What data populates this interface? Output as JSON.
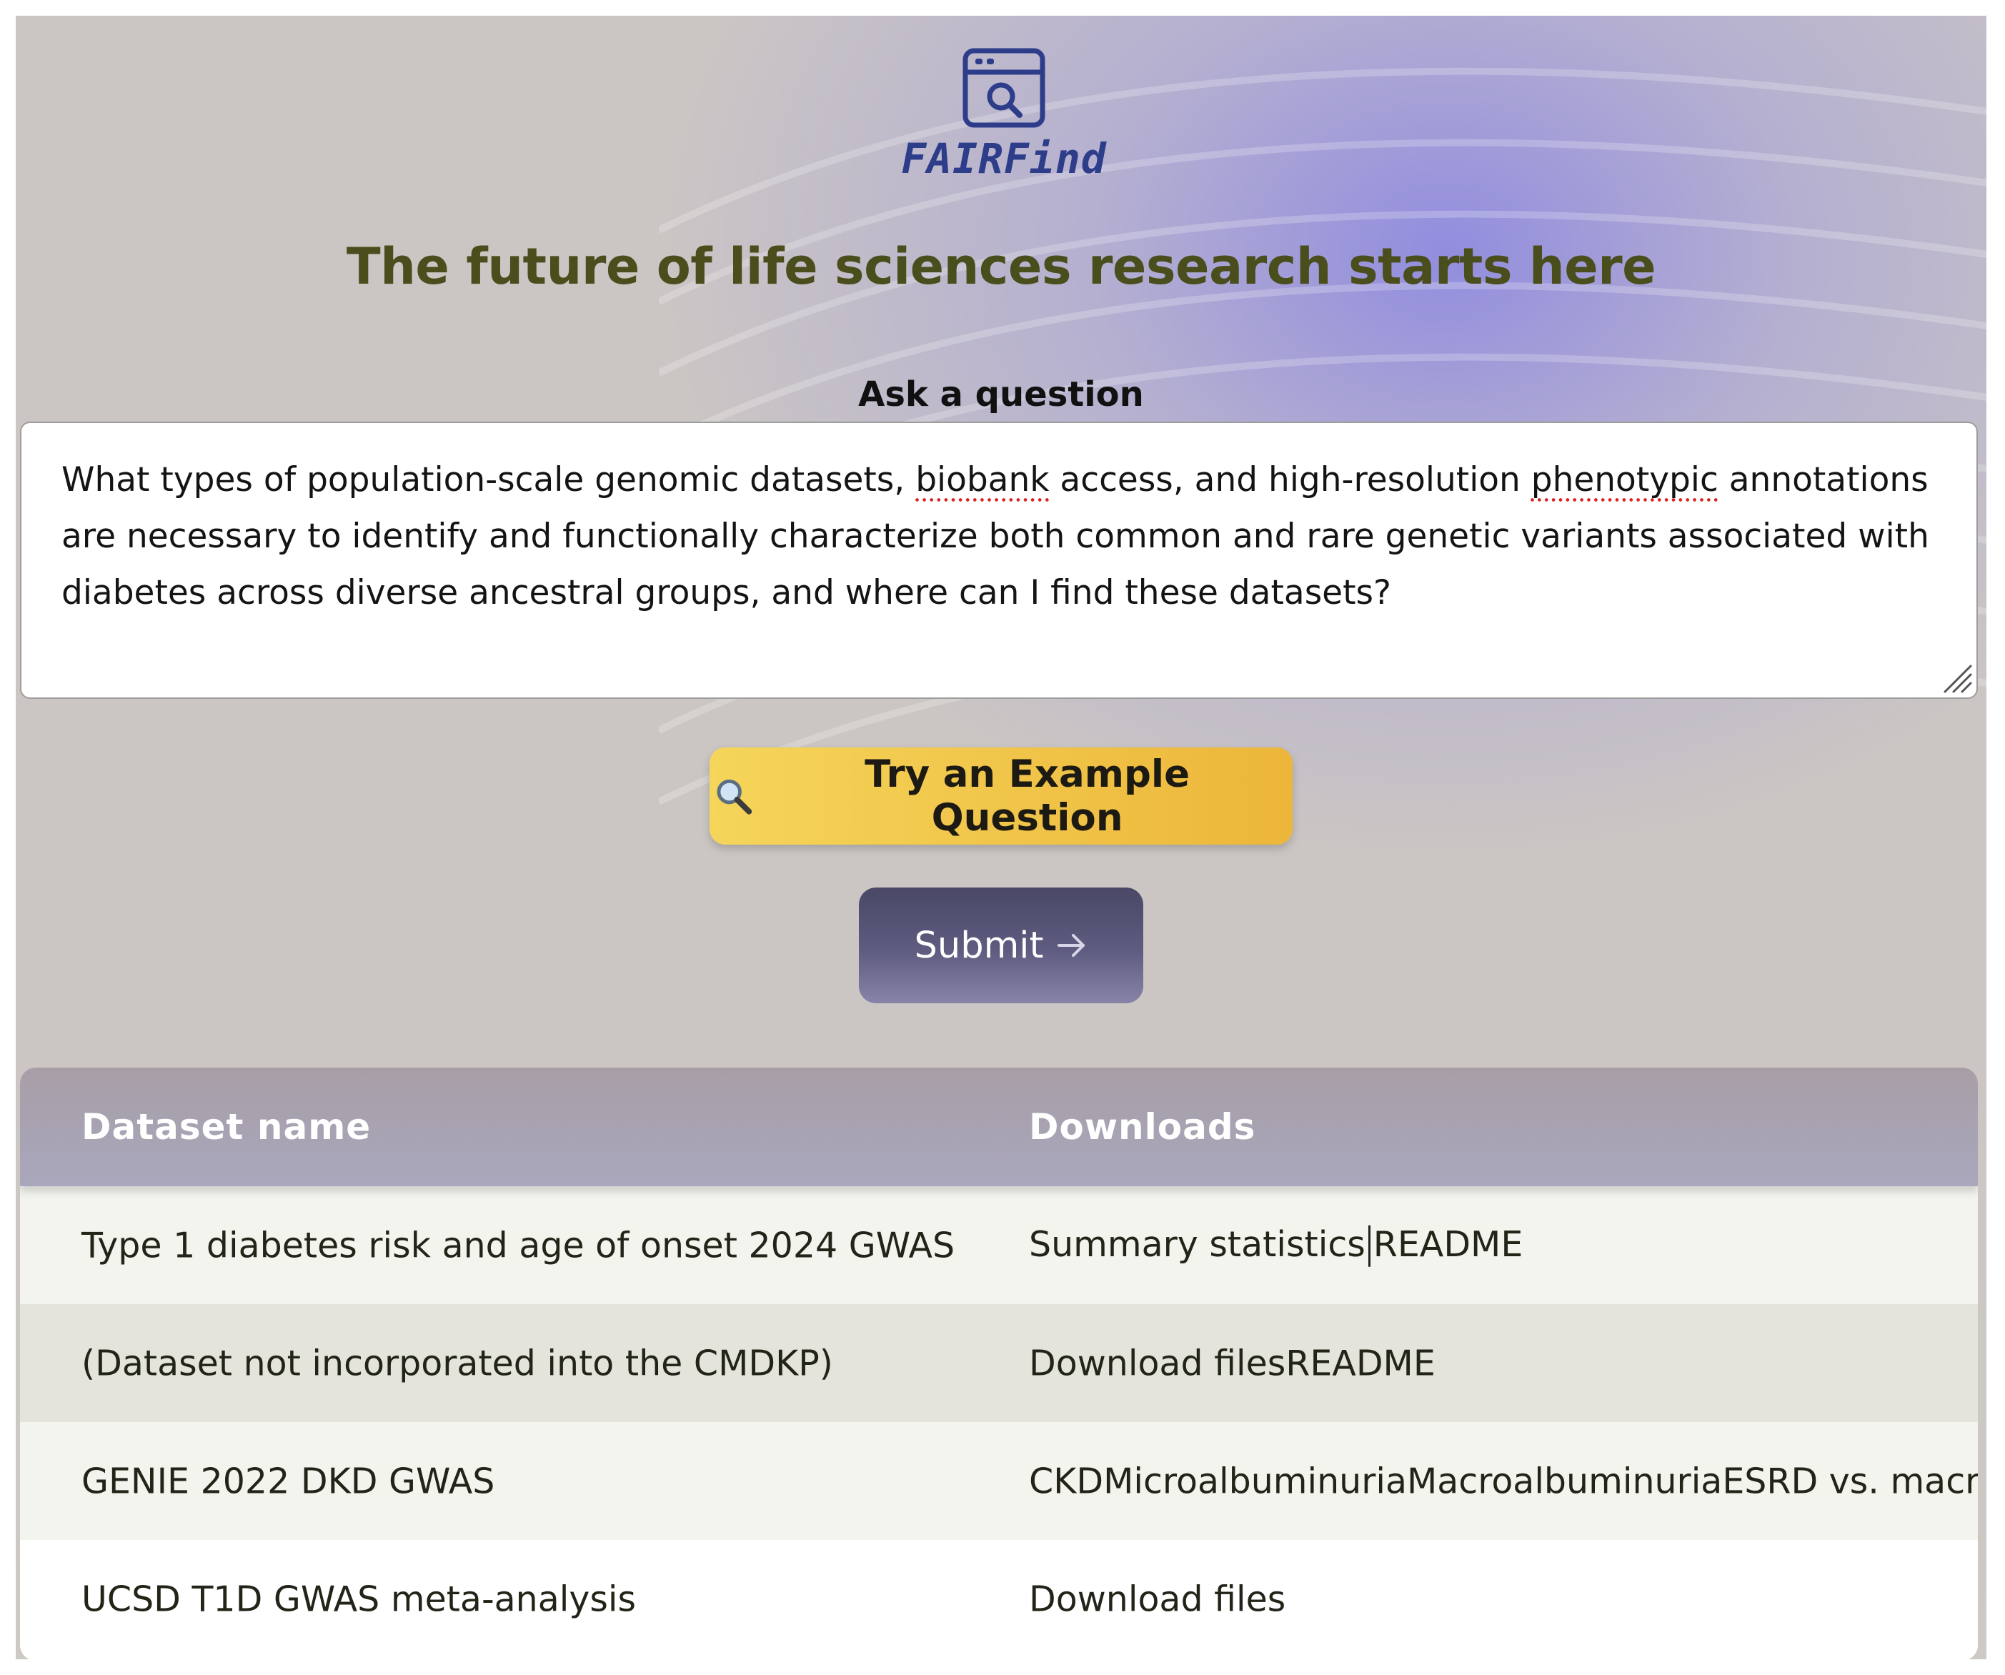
{
  "brand": {
    "name": "FAIRFind",
    "logo_icon": "browser-search-icon"
  },
  "headline": "The future of life sciences research starts here",
  "question": {
    "label": "Ask a question",
    "lines": [
      [
        "What types of population-scale genomic datasets, ",
        "biobank",
        " access, and high-resolution ",
        "phenotypic",
        " annotations"
      ],
      "are necessary to identify and functionally characterize both common and rare genetic variants associated with",
      "diabetes across diverse ancestral groups, and where can I find these datasets?"
    ]
  },
  "buttons": {
    "example": {
      "icon": "magnifier-icon",
      "label": "Try an Example Question"
    },
    "submit": {
      "label": "Submit",
      "icon": "arrow-right-icon"
    }
  },
  "results": {
    "columns": [
      "Dataset name",
      "Downloads"
    ],
    "rows": [
      {
        "name": "Type 1 diabetes risk and age of onset 2024 GWAS",
        "downloads": [
          "Summary statistics",
          "README"
        ],
        "separator": true
      },
      {
        "name": "(Dataset not incorporated into the CMDKP)",
        "downloads": [
          "Download files",
          "README"
        ],
        "separator": false
      },
      {
        "name": "GENIE 2022 DKD GWAS",
        "downloads": [
          "CKD",
          "Microalbuminuria",
          "Macroalbuminuria",
          "ESRD vs. macroalb"
        ],
        "separator": false
      },
      {
        "name": "UCSD T1D GWAS meta-analysis",
        "downloads": [
          "Download files"
        ],
        "separator": false
      }
    ]
  },
  "colors": {
    "headline": "#4a4e1c",
    "brand": "#2d3d8a",
    "example_button": "#f0c648",
    "submit_button": "#5e5c80",
    "table_header": "#a9a3b3"
  }
}
